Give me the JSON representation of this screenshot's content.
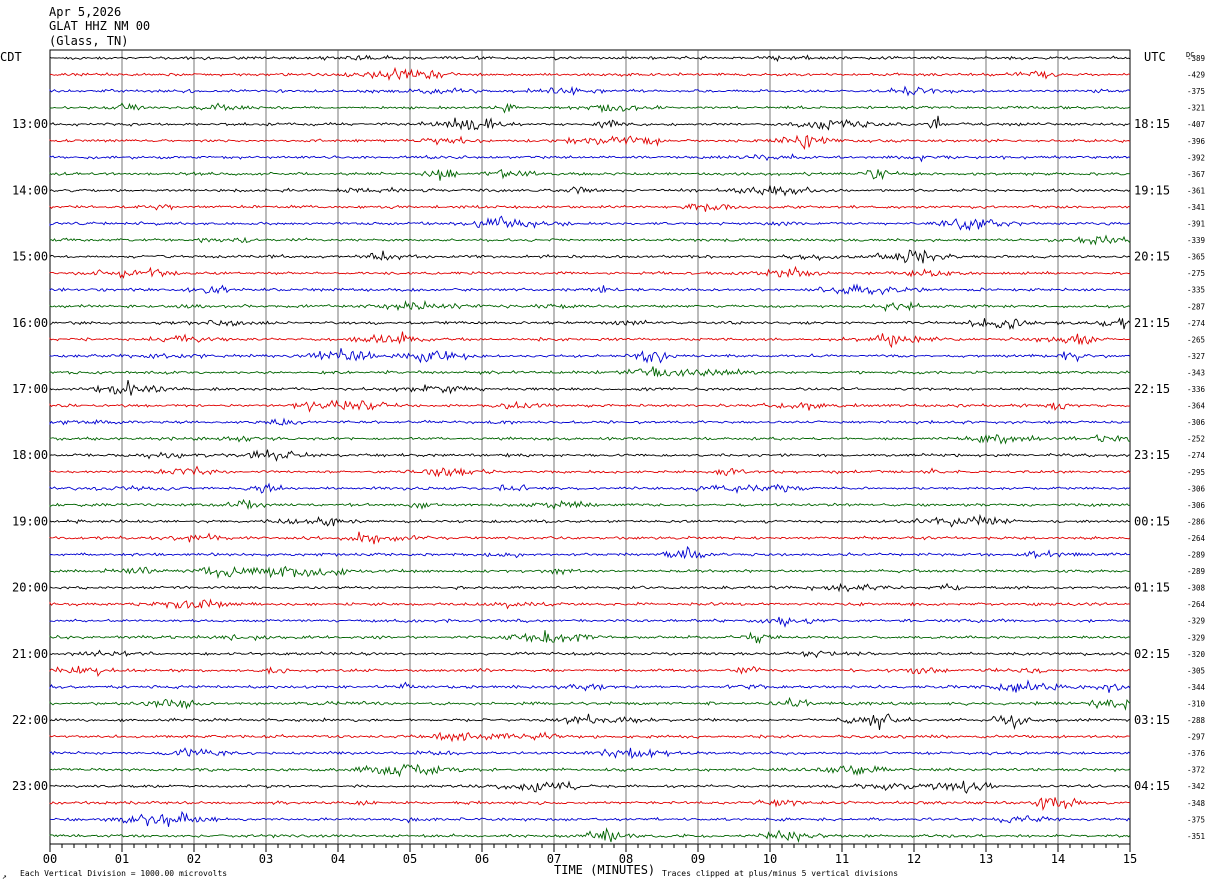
{
  "header": {
    "date": "Apr 5,2026",
    "station": "GLAT HHZ NM 00",
    "location": "(Glass, TN)"
  },
  "chart_data": {
    "type": "line",
    "title": "",
    "left_axis_label": "CDT",
    "right_axis_label": "UTC",
    "dc_label": "DC",
    "xlabel": "TIME (MINUTES)",
    "xlim": [
      0,
      15
    ],
    "x_ticks": [
      "00",
      "01",
      "02",
      "03",
      "04",
      "05",
      "06",
      "07",
      "08",
      "09",
      "10",
      "11",
      "12",
      "13",
      "14",
      "15"
    ],
    "left_hour_labels": [
      "13:00",
      "14:00",
      "15:00",
      "16:00",
      "17:00",
      "18:00",
      "19:00",
      "20:00",
      "21:00",
      "22:00",
      "23:00"
    ],
    "right_hour_labels": [
      "18:15",
      "19:15",
      "20:15",
      "21:15",
      "22:15",
      "23:15",
      "00:15",
      "01:15",
      "02:15",
      "03:15",
      "04:15"
    ],
    "trace_colors": [
      "#000000",
      "#e00000",
      "#0000d0",
      "#006400"
    ],
    "dc_offsets": [
      "-389",
      "-429",
      "-375",
      "-321",
      "-407",
      "-396",
      "-392",
      "-367",
      "-361",
      "-341",
      "-391",
      "-339",
      "-365",
      "-275",
      "-335",
      "-287",
      "-274",
      "-265",
      "-327",
      "-343",
      "-336",
      "-364",
      "-306",
      "-252",
      "-274",
      "-295",
      "-306",
      "-306",
      "-286",
      "-264",
      "-289",
      "-289",
      "-308",
      "-264",
      "-329",
      "-329",
      "-320",
      "-305",
      "-344",
      "-310",
      "-288",
      "-297",
      "-376",
      "-372",
      "-342",
      "-348",
      "-375",
      "-351"
    ],
    "footer_left": "Each Vertical Division = 1000.00 microvolts",
    "footer_right": "Traces clipped at plus/minus 5 vertical divisions",
    "grid": true
  },
  "icons": {
    "corner_mark": "scale-glyph-icon"
  }
}
